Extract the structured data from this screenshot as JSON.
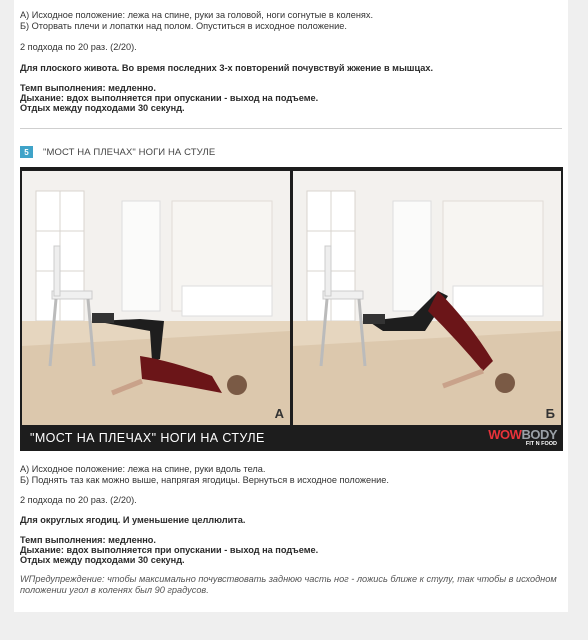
{
  "top_section": {
    "line_a": "А) Исходное положение: лежа на спине, руки за головой, ноги согнутые в коленях.",
    "line_b": "Б) Оторвать плечи и лопатки над полом. Опуститься в исходное положение.",
    "sets": "2 подхода по 20 раз. (2/20).",
    "purpose": "Для плоского живота. Во время последних 3-х повторений почувствуй жжение в мышцах.",
    "tempo": "Темп выполнения: медленно.",
    "breathing": "Дыхание: вдох выполняется при опускании - выход на подъеме.",
    "rest": "Отдых между подходами 30 секунд."
  },
  "exercise": {
    "number": "5",
    "title": "\"МОСТ НА ПЛЕЧАХ\" НОГИ НА СТУЛЕ",
    "image": {
      "panel_a_letter": "А",
      "panel_b_letter": "Б",
      "caption": "\"МОСТ НА ПЛЕЧАХ\" НОГИ НА СТУЛЕ",
      "brand_wow": "WOW",
      "brand_body": "BODY",
      "brand_sub": "FIT N FOOD"
    },
    "line_a": "А) Исходное положение: лежа на спине, руки вдоль тела.",
    "line_b": "Б) Поднять таз как можно выше, напрягая ягодицы. Вернуться в исходное положение.",
    "sets": "2 подхода по 20 раз. (2/20).",
    "purpose": "Для округлых ягодиц.  И уменьшение целлюлита.",
    "tempo": "Темп выполнения: медленно.",
    "breathing": "Дыхание: вдох выполняется при опускании - выход на подъеме.",
    "rest": "Отдых между подходами 30 секунд.",
    "warning": "WПредупреждение: чтобы максимально почувствовать заднюю часть ног - ложись ближе к стулу, так чтобы в исходном положении угол в коленях был 90 градусов."
  }
}
